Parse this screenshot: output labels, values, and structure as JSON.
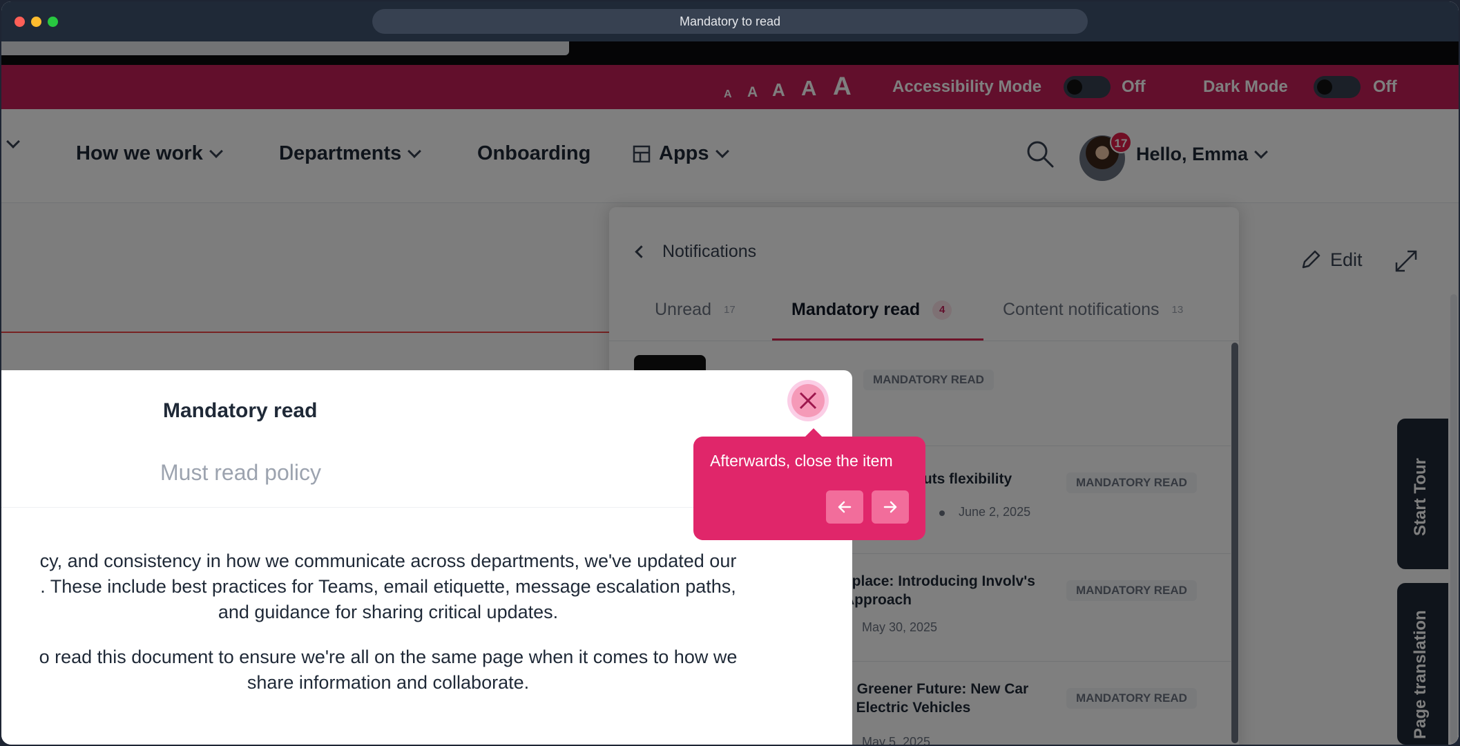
{
  "browser": {
    "url_title": "Mandatory to read"
  },
  "topbar": {
    "font_sizes": [
      "A",
      "A",
      "A",
      "A",
      "A"
    ],
    "accessibility_label": "Accessibility Mode",
    "accessibility_state": "Off",
    "dark_mode_label": "Dark Mode",
    "dark_mode_state": "Off"
  },
  "nav": {
    "items": [
      "How we work",
      "Departments",
      "Onboarding",
      "Apps"
    ],
    "greeting": "Hello, Emma",
    "notification_count": "17"
  },
  "toolbar": {
    "edit_label": "Edit"
  },
  "notifications": {
    "title": "Notifications",
    "tabs": [
      {
        "label": "Unread",
        "count": "17"
      },
      {
        "label": "Mandatory read",
        "count": "4"
      },
      {
        "label": "Content notifications",
        "count": "13"
      }
    ],
    "items": [
      {
        "badge": "MANDATORY READ",
        "title": "",
        "date": ""
      },
      {
        "badge": "MANDATORY READ",
        "title": "outs flexibility",
        "date": "June 2, 2025"
      },
      {
        "badge": "MANDATORY READ",
        "title_line1": "kplace: Introducing Involv's",
        "title_line2": "Approach",
        "date": "May 30, 2025"
      },
      {
        "badge": "MANDATORY READ",
        "title_line1": "n Greener Future: New Car",
        "title_line2": "s Electric Vehicles",
        "date": "May 5, 2025"
      }
    ]
  },
  "side_tabs": {
    "start_tour": "Start Tour",
    "page_translation": "Page translation"
  },
  "modal": {
    "title": "Mandatory read",
    "subtitle": "Must read policy",
    "paragraph1_line1": "cy, and consistency in how we communicate across departments, we've updated our",
    "paragraph1_line2": ". These include best practices for Teams, email etiquette, message escalation paths,",
    "paragraph1_line3": "and guidance for sharing critical updates.",
    "paragraph2_line1": "o read this document to ensure we're all on the same page when it comes to how we",
    "paragraph2_line2": "share information and collaborate."
  },
  "tooltip": {
    "text": "Afterwards, close the item"
  },
  "colors": {
    "brand": "#c41f58",
    "tooltip": "#e0266a"
  }
}
